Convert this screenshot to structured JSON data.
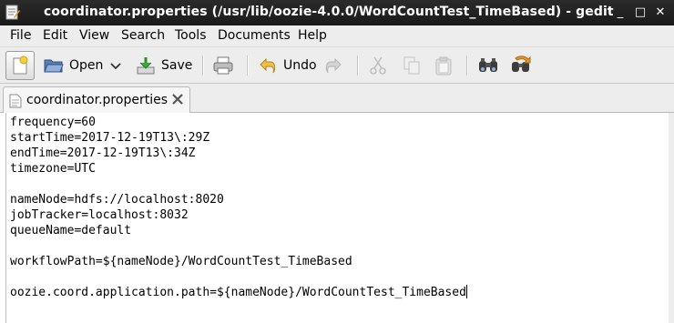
{
  "window": {
    "title": "coordinator.properties (/usr/lib/oozie-4.0.0/WordCountTest_TimeBased) - gedit",
    "controls": {
      "minimize": "_",
      "maximize": "□",
      "close": "✕"
    }
  },
  "menubar": [
    "File",
    "Edit",
    "View",
    "Search",
    "Tools",
    "Documents",
    "Help"
  ],
  "toolbar": {
    "open_label": "Open",
    "save_label": "Save",
    "undo_label": "Undo"
  },
  "tabs": [
    {
      "label": "coordinator.properties"
    }
  ],
  "editor": {
    "lines": [
      "frequency=60",
      "startTime=2017-12-19T13\\:29Z",
      "endTime=2017-12-19T13\\:34Z",
      "timezone=UTC",
      "",
      "nameNode=hdfs://localhost:8020",
      "jobTracker=localhost:8032",
      "queueName=default",
      "",
      "workflowPath=${nameNode}/WordCountTest_TimeBased",
      "",
      "oozie.coord.application.path=${nameNode}/WordCountTest_TimeBased"
    ]
  },
  "colors": {
    "titlebar_bg": "#1f1f1f",
    "chrome_bg": "#ededed",
    "editor_bg": "#ffffff"
  }
}
